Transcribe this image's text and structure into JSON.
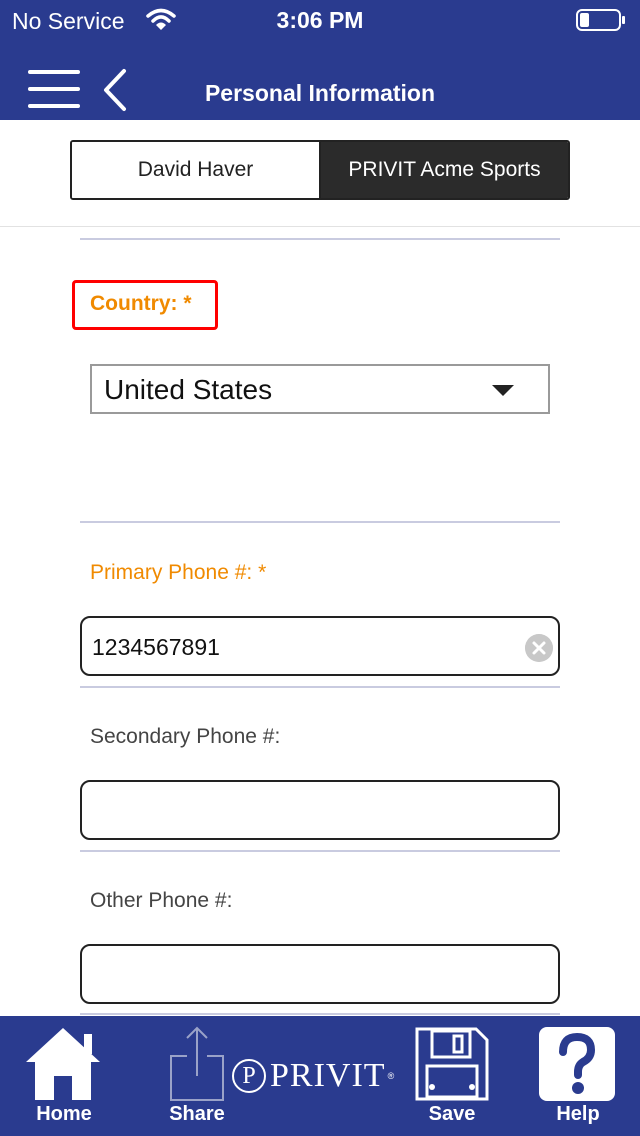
{
  "status_bar": {
    "carrier": "No Service",
    "time": "3:06 PM",
    "battery_level": 0.25
  },
  "header": {
    "title": "Personal Information",
    "menu_icon": "hamburger-menu-icon",
    "back_icon": "chevron-left-icon"
  },
  "segments": {
    "left_label": "David Haver",
    "right_label": "PRIVIT Acme Sports",
    "selected": "right"
  },
  "form": {
    "country": {
      "label": "Country: *",
      "value": "United States"
    },
    "primary_phone": {
      "label": "Primary Phone #: *",
      "value": "1234567891"
    },
    "secondary_phone": {
      "label": "Secondary Phone #:",
      "value": ""
    },
    "other_phone": {
      "label": "Other Phone #:",
      "value": ""
    }
  },
  "tabbar": {
    "home_label": "Home",
    "share_label": "Share",
    "brand_text": "PRIVIT",
    "save_label": "Save",
    "help_label": "Help"
  },
  "colors": {
    "brand_blue": "#2a3b8f",
    "required_label": "#f08a00",
    "highlight_border": "#ff0000"
  }
}
